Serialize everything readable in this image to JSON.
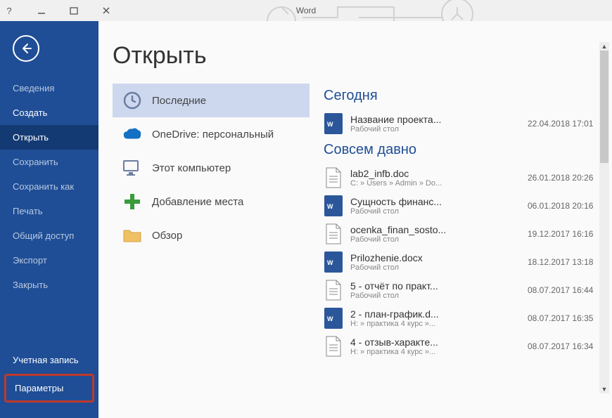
{
  "app_title": "Word",
  "help_glyph": "?",
  "page_title": "Открыть",
  "sidebar": {
    "items": [
      {
        "label": "Сведения",
        "bright": false
      },
      {
        "label": "Создать",
        "bright": true
      },
      {
        "label": "Открыть",
        "bright": true,
        "active": true
      },
      {
        "label": "Сохранить",
        "bright": false
      },
      {
        "label": "Сохранить как",
        "bright": false
      },
      {
        "label": "Печать",
        "bright": false
      },
      {
        "label": "Общий доступ",
        "bright": false
      },
      {
        "label": "Экспорт",
        "bright": false
      },
      {
        "label": "Закрыть",
        "bright": false
      }
    ],
    "account": "Учетная запись",
    "options": "Параметры"
  },
  "places": [
    {
      "icon": "clock",
      "label": "Последние",
      "selected": true
    },
    {
      "icon": "onedrive",
      "label": "OneDrive: персональный",
      "sub": "                    "
    },
    {
      "icon": "pc",
      "label": "Этот компьютер"
    },
    {
      "icon": "plus",
      "label": "Добавление места"
    },
    {
      "icon": "folder",
      "label": "Обзор"
    }
  ],
  "sections": [
    {
      "title": "Сегодня",
      "files": [
        {
          "icon": "docx",
          "name": "Название проекта...",
          "path": "Рабочий стол",
          "date": "22.04.2018 17:01"
        }
      ]
    },
    {
      "title": "Совсем давно",
      "files": [
        {
          "icon": "doc",
          "name": "lab2_infb.doc",
          "path": "C: » Users » Admin » Do...",
          "date": "26.01.2018 20:26"
        },
        {
          "icon": "docx",
          "name": "Сущность финанс...",
          "path": "Рабочий стол",
          "date": "06.01.2018 20:16"
        },
        {
          "icon": "doc",
          "name": "ocenka_finan_sosto...",
          "path": "Рабочий стол",
          "date": "19.12.2017 16:16"
        },
        {
          "icon": "docx",
          "name": "Prilozhenie.docx",
          "path": "Рабочий стол",
          "date": "18.12.2017 13:18"
        },
        {
          "icon": "doc",
          "name": "5 - отчёт по практ...",
          "path": "Рабочий стол",
          "date": "08.07.2017 16:44"
        },
        {
          "icon": "docx",
          "name": "2 - план-график.d...",
          "path": "H: » практика 4 курс »...",
          "date": "08.07.2017 16:35"
        },
        {
          "icon": "doc",
          "name": "4 - отзыв-характе...",
          "path": "H: » практика 4 курс »...",
          "date": "08.07.2017 16:34"
        }
      ]
    }
  ]
}
